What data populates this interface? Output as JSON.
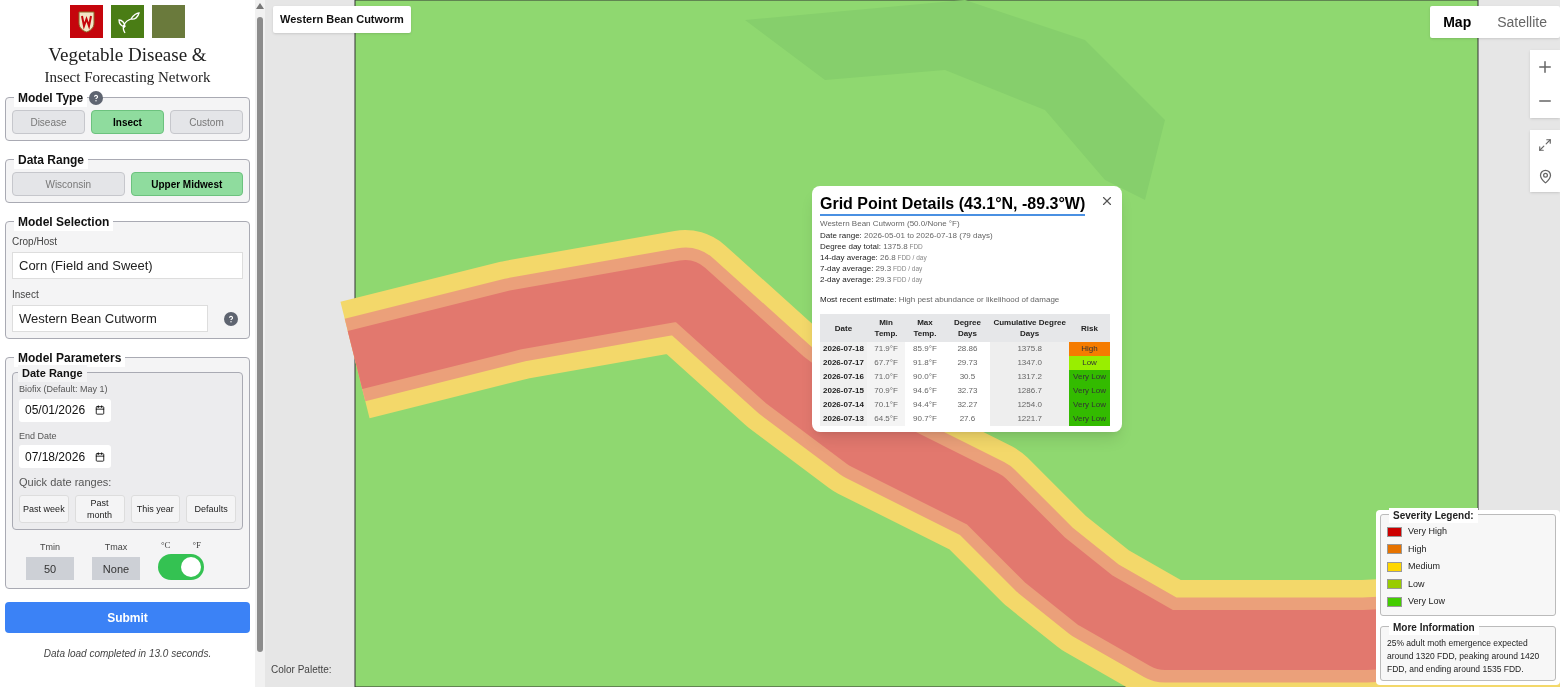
{
  "header": {
    "title_line1": "Vegetable Disease &",
    "title_line2": "Insect Forecasting Network"
  },
  "model_type": {
    "legend": "Model Type",
    "options": [
      {
        "label": "Disease",
        "selected": false
      },
      {
        "label": "Insect",
        "selected": true
      },
      {
        "label": "Custom",
        "selected": false
      }
    ]
  },
  "data_range": {
    "legend": "Data Range",
    "options": [
      {
        "label": "Wisconsin",
        "selected": false
      },
      {
        "label": "Upper Midwest",
        "selected": true
      }
    ]
  },
  "model_selection": {
    "legend": "Model Selection",
    "crop_label": "Crop/Host",
    "crop_value": "Corn (Field and Sweet)",
    "insect_label": "Insect",
    "insect_value": "Western Bean Cutworm"
  },
  "model_parameters": {
    "legend": "Model Parameters",
    "date_range": {
      "legend": "Date Range",
      "biofix_label": "Biofix (Default: May 1)",
      "biofix_value": "05/01/2026",
      "end_label": "End Date",
      "end_value": "07/18/2026",
      "quick_label": "Quick date ranges:",
      "quick_buttons": [
        "Past week",
        "Past month",
        "This year",
        "Defaults"
      ]
    },
    "tmin_label": "Tmin",
    "tmin_value": "50",
    "tmax_label": "Tmax",
    "tmax_value": "None",
    "unit_c": "°C",
    "unit_f": "°F",
    "fahrenheit_on": true
  },
  "submit": "Submit",
  "status": "Data load completed in 13.0 seconds.",
  "map": {
    "layer_title": "Western Bean Cutworm",
    "map_types": [
      {
        "label": "Map",
        "selected": true
      },
      {
        "label": "Satellite",
        "selected": false
      }
    ],
    "palette_label": "Color Palette:"
  },
  "popup": {
    "title": "Grid Point Details (43.1°N, -89.3°W)",
    "subtitle": "Western Bean Cutworm (50.0/None °F)",
    "lines": [
      {
        "label": "Date range:",
        "value": "2026-05-01 to 2026-07-18 (79 days)"
      },
      {
        "label": "Degree day total:",
        "value": "1375.8",
        "unit": "FDD"
      },
      {
        "label": "14-day average:",
        "value": "26.8",
        "unit": "FDD / day"
      },
      {
        "label": "7-day average:",
        "value": "29.3",
        "unit": "FDD / day"
      },
      {
        "label": "2-day average:",
        "value": "29.3",
        "unit": "FDD / day"
      }
    ],
    "estimate_label": "Most recent estimate:",
    "estimate_value": "High pest abundance or likelihood of damage",
    "columns": [
      "Date",
      "Min Temp.",
      "Max Temp.",
      "Degree Days",
      "Cumulative Degree Days",
      "Risk"
    ],
    "rows": [
      {
        "date": "2026-07-18",
        "min": "71.9°F",
        "max": "85.9°F",
        "dd": "28.86",
        "cum": "1375.8",
        "risk": "High",
        "color": "#f57c00"
      },
      {
        "date": "2026-07-17",
        "min": "67.7°F",
        "max": "91.8°F",
        "dd": "29.73",
        "cum": "1347.0",
        "risk": "Low",
        "color": "#99ee00"
      },
      {
        "date": "2026-07-16",
        "min": "71.0°F",
        "max": "90.0°F",
        "dd": "30.5",
        "cum": "1317.2",
        "risk": "Very Low",
        "color": "#33bb00"
      },
      {
        "date": "2026-07-15",
        "min": "70.9°F",
        "max": "94.6°F",
        "dd": "32.73",
        "cum": "1286.7",
        "risk": "Very Low",
        "color": "#33bb00"
      },
      {
        "date": "2026-07-14",
        "min": "70.1°F",
        "max": "94.4°F",
        "dd": "32.27",
        "cum": "1254.0",
        "risk": "Very Low",
        "color": "#33bb00"
      },
      {
        "date": "2026-07-13",
        "min": "64.5°F",
        "max": "90.7°F",
        "dd": "27.6",
        "cum": "1221.7",
        "risk": "Very Low",
        "color": "#33bb00"
      }
    ]
  },
  "legend": {
    "title": "Severity Legend:",
    "items": [
      {
        "label": "Very High",
        "color": "#cc0000"
      },
      {
        "label": "High",
        "color": "#e67300"
      },
      {
        "label": "Medium",
        "color": "#ffd700"
      },
      {
        "label": "Low",
        "color": "#99cc00"
      },
      {
        "label": "Very Low",
        "color": "#44cc00"
      }
    ]
  },
  "more_info": {
    "title": "More Information",
    "text": "25% adult moth emergence expected around 1320 FDD, peaking around 1420 FDD, and ending around 1535 FDD."
  }
}
